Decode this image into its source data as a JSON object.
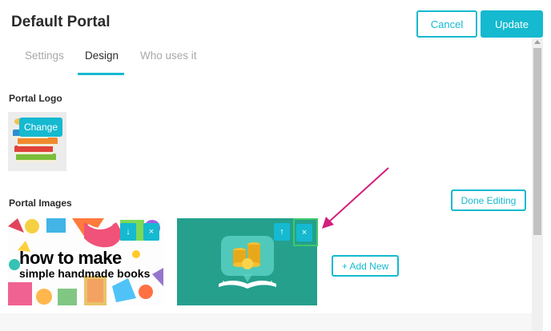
{
  "header": {
    "title": "Default Portal",
    "cancel_label": "Cancel",
    "update_label": "Update"
  },
  "tabs": [
    {
      "label": "Settings",
      "active": false
    },
    {
      "label": "Design",
      "active": true
    },
    {
      "label": "Who uses it",
      "active": false
    }
  ],
  "logo_section": {
    "label": "Portal Logo",
    "change_label": "Change"
  },
  "images_section": {
    "label": "Portal Images",
    "done_editing_label": "Done Editing",
    "add_new_label": "+ Add New",
    "images": [
      {
        "overlay_line1": "how to make",
        "overlay_line2": "simple handmade books",
        "move_icon": "arrow-down-icon",
        "remove_icon": "close-icon"
      },
      {
        "move_icon": "arrow-up-icon",
        "remove_icon": "close-icon"
      }
    ]
  },
  "colors": {
    "accent": "#15b9d0",
    "highlight": "#3fc86a",
    "annotation_arrow": "#d41f7c",
    "image2_bg": "#24a08d"
  },
  "icons": {
    "down": "↓",
    "up": "↑",
    "close": "×"
  }
}
